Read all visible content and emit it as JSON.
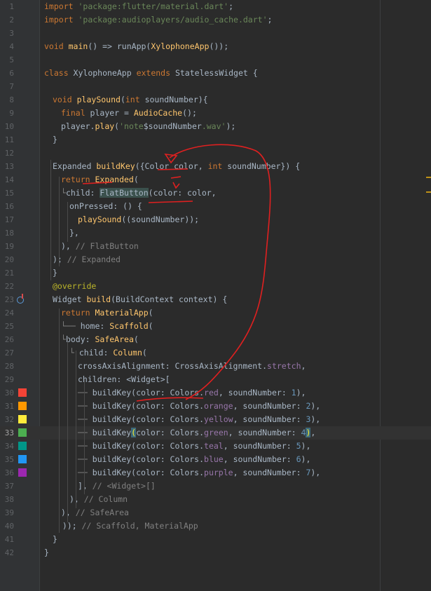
{
  "editor": {
    "lines": [
      {
        "n": "1",
        "indent": 0,
        "tokens": [
          [
            "k",
            "import "
          ],
          [
            "s",
            "'package:flutter/material.dart'"
          ],
          [
            "",
            "; "
          ]
        ]
      },
      {
        "n": "2",
        "indent": 0,
        "tokens": [
          [
            "k",
            "import "
          ],
          [
            "s",
            "'package:audioplayers/audio_cache.dart'"
          ],
          [
            "",
            ";"
          ]
        ]
      },
      {
        "n": "3",
        "indent": 0,
        "tokens": []
      },
      {
        "n": "4",
        "indent": 0,
        "tokens": [
          [
            "k",
            "void "
          ],
          [
            "f",
            "main"
          ],
          [
            "",
            "() => runApp("
          ],
          [
            "f",
            "XylophoneApp"
          ],
          [
            "",
            "());"
          ]
        ]
      },
      {
        "n": "5",
        "indent": 0,
        "tokens": []
      },
      {
        "n": "6",
        "indent": 0,
        "tokens": [
          [
            "k",
            "class "
          ],
          [
            "",
            "XylophoneApp "
          ],
          [
            "k",
            "extends "
          ],
          [
            "",
            "StatelessWidget {"
          ]
        ]
      },
      {
        "n": "7",
        "indent": 0,
        "tokens": []
      },
      {
        "n": "8",
        "indent": 1,
        "tokens": [
          [
            "k",
            "void "
          ],
          [
            "f",
            "playSound"
          ],
          [
            "",
            "("
          ],
          [
            "k",
            "int "
          ],
          [
            "",
            "soundNumber){"
          ]
        ]
      },
      {
        "n": "9",
        "indent": 2,
        "tokens": [
          [
            "k",
            "final "
          ],
          [
            "",
            "player = "
          ],
          [
            "f",
            "AudioCache"
          ],
          [
            "",
            "();"
          ]
        ]
      },
      {
        "n": "10",
        "indent": 2,
        "tokens": [
          [
            "",
            "player."
          ],
          [
            "f",
            "play"
          ],
          [
            "",
            "("
          ],
          [
            "s",
            "'note"
          ],
          [
            "",
            "$soundNumber"
          ],
          [
            "s",
            ".wav'"
          ],
          [
            "",
            ");"
          ]
        ]
      },
      {
        "n": "11",
        "indent": 1,
        "tokens": [
          [
            "",
            "}"
          ]
        ]
      },
      {
        "n": "12",
        "indent": 0,
        "tokens": []
      },
      {
        "n": "13",
        "indent": 1,
        "tokens": [
          [
            "",
            "Expanded "
          ],
          [
            "f",
            "buildKey"
          ],
          [
            "",
            "({Color color, "
          ],
          [
            "k",
            "int "
          ],
          [
            "",
            "soundNumber}) {"
          ]
        ]
      },
      {
        "n": "14",
        "indent": 2,
        "tokens": [
          [
            "k",
            "return "
          ],
          [
            "f",
            "Expanded"
          ],
          [
            "",
            "("
          ]
        ]
      },
      {
        "n": "15",
        "indent": 2,
        "tokens": [
          [
            "c",
            "└"
          ],
          [
            "",
            "child: "
          ],
          [
            "hl",
            "FlatButton"
          ],
          [
            "",
            "(color: color,"
          ]
        ]
      },
      {
        "n": "16",
        "indent": 3,
        "tokens": [
          [
            "",
            "onPressed: () {"
          ]
        ]
      },
      {
        "n": "17",
        "indent": 4,
        "tokens": [
          [
            "f",
            "playSound"
          ],
          [
            "",
            "((soundNumber));"
          ]
        ]
      },
      {
        "n": "18",
        "indent": 3,
        "tokens": [
          [
            "",
            "},"
          ]
        ]
      },
      {
        "n": "19",
        "indent": 2,
        "tokens": [
          [
            "",
            "), "
          ],
          [
            "c",
            "// FlatButton"
          ]
        ]
      },
      {
        "n": "20",
        "indent": 1,
        "tokens": [
          [
            "",
            "); "
          ],
          [
            "c",
            "// Expanded"
          ]
        ]
      },
      {
        "n": "21",
        "indent": 1,
        "tokens": [
          [
            "",
            "}"
          ]
        ]
      },
      {
        "n": "22",
        "indent": 1,
        "tokens": [
          [
            "a",
            "@override"
          ]
        ]
      },
      {
        "n": "23",
        "indent": 1,
        "tokens": [
          [
            "",
            "Widget "
          ],
          [
            "f",
            "build"
          ],
          [
            "",
            "(BuildContext context) {"
          ]
        ]
      },
      {
        "n": "24",
        "indent": 2,
        "tokens": [
          [
            "k",
            "return "
          ],
          [
            "f",
            "MaterialApp"
          ],
          [
            "",
            "("
          ]
        ]
      },
      {
        "n": "25",
        "indent": 2,
        "tokens": [
          [
            "c",
            "└── "
          ],
          [
            "",
            "home: "
          ],
          [
            "f",
            "Scaffold"
          ],
          [
            "",
            "("
          ]
        ]
      },
      {
        "n": "26",
        "indent": 2,
        "tokens": [
          [
            "c",
            "└"
          ],
          [
            "",
            "body: "
          ],
          [
            "f",
            "SafeArea"
          ],
          [
            "",
            "("
          ]
        ]
      },
      {
        "n": "27",
        "indent": 3,
        "tokens": [
          [
            "c",
            "└ "
          ],
          [
            "",
            "child: "
          ],
          [
            "f",
            "Column"
          ],
          [
            "",
            "("
          ]
        ]
      },
      {
        "n": "28",
        "indent": 4,
        "tokens": [
          [
            "",
            "crossAxisAlignment: CrossAxisAlignment."
          ],
          [
            "p",
            "stretch"
          ],
          [
            "",
            ","
          ]
        ]
      },
      {
        "n": "29",
        "indent": 4,
        "tokens": [
          [
            "",
            "children: <Widget>["
          ]
        ]
      },
      {
        "n": "30",
        "indent": 4,
        "tokens": [
          [
            "c",
            "── "
          ],
          [
            "",
            "buildKey(color: Colors."
          ],
          [
            "p",
            "red"
          ],
          [
            "",
            ", soundNumber: "
          ],
          [
            "n",
            "1"
          ],
          [
            "",
            "),"
          ]
        ]
      },
      {
        "n": "31",
        "indent": 4,
        "tokens": [
          [
            "c",
            "── "
          ],
          [
            "",
            "buildKey(color: Colors."
          ],
          [
            "p",
            "orange"
          ],
          [
            "",
            ", soundNumber: "
          ],
          [
            "n",
            "2"
          ],
          [
            "",
            "),"
          ]
        ]
      },
      {
        "n": "32",
        "indent": 4,
        "tokens": [
          [
            "c",
            "── "
          ],
          [
            "",
            "buildKey(color: Colors."
          ],
          [
            "p",
            "yellow"
          ],
          [
            "",
            ", soundNumber: "
          ],
          [
            "n",
            "3"
          ],
          [
            "",
            "),"
          ]
        ]
      },
      {
        "n": "33",
        "indent": 4,
        "tokens": [
          [
            "c",
            "── "
          ],
          [
            "",
            "buildKey"
          ],
          [
            "brk",
            "("
          ],
          [
            "",
            "color: Colors."
          ],
          [
            "p",
            "green"
          ],
          [
            "",
            ", soundNumber: "
          ],
          [
            "n",
            "4"
          ],
          [
            "brk",
            ")"
          ],
          [
            "",
            ","
          ]
        ]
      },
      {
        "n": "34",
        "indent": 4,
        "tokens": [
          [
            "c",
            "── "
          ],
          [
            "",
            "buildKey(color: Colors."
          ],
          [
            "p",
            "teal"
          ],
          [
            "",
            ", soundNumber: "
          ],
          [
            "n",
            "5"
          ],
          [
            "",
            "),"
          ]
        ]
      },
      {
        "n": "35",
        "indent": 4,
        "tokens": [
          [
            "c",
            "── "
          ],
          [
            "",
            "buildKey(color: Colors."
          ],
          [
            "p",
            "blue"
          ],
          [
            "",
            ", soundNumber: "
          ],
          [
            "n",
            "6"
          ],
          [
            "",
            "),"
          ]
        ]
      },
      {
        "n": "36",
        "indent": 4,
        "tokens": [
          [
            "c",
            "── "
          ],
          [
            "",
            "buildKey(color: Colors."
          ],
          [
            "p",
            "purple"
          ],
          [
            "",
            ", soundNumber: "
          ],
          [
            "n",
            "7"
          ],
          [
            "",
            "),"
          ]
        ]
      },
      {
        "n": "37",
        "indent": 4,
        "tokens": [
          [
            "",
            "], "
          ],
          [
            "c",
            "// <Widget>[]"
          ]
        ]
      },
      {
        "n": "38",
        "indent": 3,
        "tokens": [
          [
            "",
            "), "
          ],
          [
            "c",
            "// Column"
          ]
        ]
      },
      {
        "n": "39",
        "indent": 2,
        "tokens": [
          [
            "",
            "), "
          ],
          [
            "c",
            "// SafeArea"
          ]
        ]
      },
      {
        "n": "40",
        "indent": 1,
        "tokens": [
          [
            "",
            "  )); "
          ],
          [
            "c",
            "// Scaffold, MaterialApp"
          ]
        ]
      },
      {
        "n": "41",
        "indent": 1,
        "tokens": [
          [
            "",
            "}"
          ]
        ]
      },
      {
        "n": "42",
        "indent": 0,
        "tokens": [
          [
            "",
            "}"
          ]
        ]
      }
    ],
    "current_line": "33",
    "gutter_swatches": [
      {
        "line": "30",
        "color": "#f44336",
        "name": "red-swatch-icon"
      },
      {
        "line": "31",
        "color": "#ff9800",
        "name": "orange-swatch-icon"
      },
      {
        "line": "32",
        "color": "#ffeb3b",
        "name": "yellow-swatch-icon"
      },
      {
        "line": "33",
        "color": "#4caf50",
        "name": "green-swatch-icon"
      },
      {
        "line": "34",
        "color": "#009688",
        "name": "teal-swatch-icon"
      },
      {
        "line": "35",
        "color": "#2196f3",
        "name": "blue-swatch-icon"
      },
      {
        "line": "36",
        "color": "#9c27b0",
        "name": "purple-swatch-icon"
      }
    ],
    "override_marker_line": "23",
    "annotation_color": "#e02020"
  }
}
